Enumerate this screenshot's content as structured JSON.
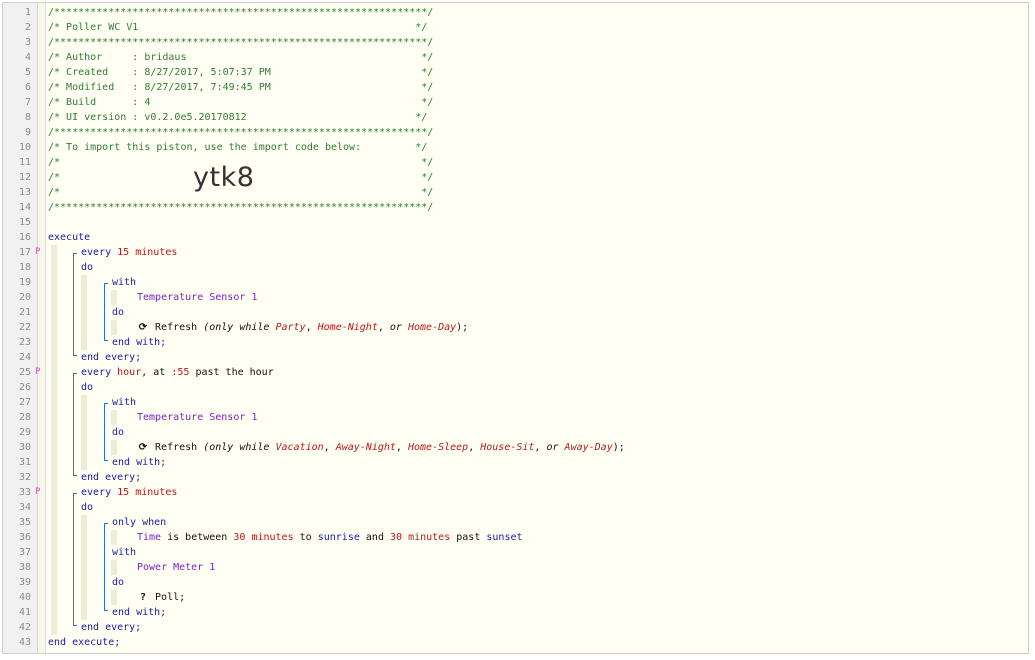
{
  "gutter": {
    "line_numbers": [
      "1",
      "2",
      "3",
      "4",
      "5",
      "6",
      "7",
      "8",
      "9",
      "10",
      "11",
      "12",
      "13",
      "14",
      "15",
      "16",
      "17",
      "18",
      "19",
      "20",
      "21",
      "22",
      "23",
      "24",
      "25",
      "26",
      "27",
      "28",
      "29",
      "30",
      "31",
      "32",
      "33",
      "34",
      "35",
      "36",
      "37",
      "38",
      "39",
      "40",
      "41",
      "42",
      "43"
    ],
    "markers": [
      {
        "line": 17,
        "symbol": "P"
      },
      {
        "line": 25,
        "symbol": "P"
      },
      {
        "line": 33,
        "symbol": "P"
      }
    ]
  },
  "header": {
    "border_line": "/**************************************************************/",
    "title": "/* Poller WC V1                                              */",
    "author": "/* Author     : bridaus                                       */",
    "created": "/* Created    : 8/27/2017, 5:07:37 PM                         */",
    "modified": "/* Modified   : 8/27/2017, 7:49:45 PM                         */",
    "build": "/* Build      : 4                                             */",
    "ui_version": "/* UI version : v0.2.0e5.20170812                            */",
    "import_line": "/* To import this piston, use the import code below:         */",
    "blank_line": "/*                                                            */",
    "import_code": "ytk8"
  },
  "code": {
    "execute": "execute",
    "end_execute": "end execute;",
    "every": "every",
    "do": "do",
    "with": "with",
    "end_with": "end with;",
    "end_every": "end every;",
    "only_when": "only when",
    "blocks": [
      {
        "schedule_num": "15",
        "schedule_unit": "minutes",
        "device": "Temperature Sensor 1",
        "action_icon": "⟳",
        "action": "Refresh",
        "only_while_prefix": "(only while",
        "modes": [
          "Party",
          "Home-Night",
          "Home-Day"
        ],
        "suffix": ");"
      },
      {
        "schedule_unit": "hour",
        "schedule_rest": ", at",
        "schedule_time": ":55",
        "schedule_tail": "past the hour",
        "device": "Temperature Sensor 1",
        "action_icon": "⟳",
        "action": "Refresh",
        "only_while_prefix": "(only while",
        "modes": [
          "Vacation",
          "Away-Night",
          "Home-Sleep",
          "House-Sit",
          "Away-Day"
        ],
        "suffix": ");"
      },
      {
        "schedule_num": "15",
        "schedule_unit": "minutes",
        "condition": {
          "subject": "Time",
          "op": "is between",
          "a_num": "30",
          "a_unit": "minutes",
          "to": "to",
          "a_ref": "sunrise",
          "and": "and",
          "b_num": "30",
          "b_unit": "minutes",
          "past": "past",
          "b_ref": "sunset"
        },
        "device": "Power Meter 1",
        "action_icon": "?",
        "action": "Poll;"
      }
    ]
  },
  "colors": {
    "comment": "#2e7d32",
    "keyword": "#1a1aa6",
    "device": "#7b25c2",
    "value": "#b31b1b",
    "bracket": "#2f6fd6",
    "marker": "#d24bd8",
    "background": "#fffff3"
  }
}
